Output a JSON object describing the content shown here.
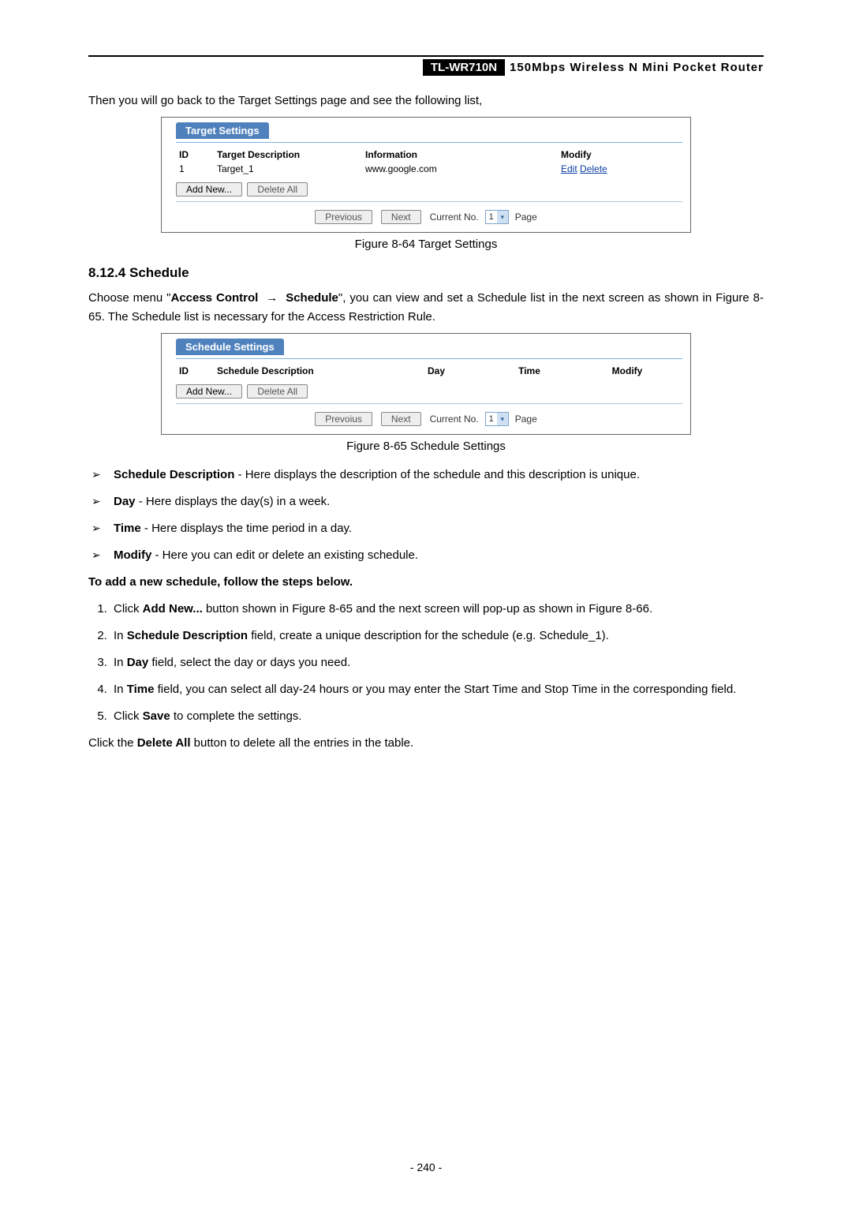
{
  "header": {
    "model": "TL-WR710N",
    "title": "150Mbps Wireless N Mini Pocket Router"
  },
  "intro_line": "Then you will go back to the Target Settings page and see the following list,",
  "fig1": {
    "panel_title": "Target Settings",
    "headers": {
      "id": "ID",
      "desc": "Target Description",
      "info": "Information",
      "modify": "Modify"
    },
    "row": {
      "id": "1",
      "desc": "Target_1",
      "info": "www.google.com",
      "edit": "Edit",
      "delete": "Delete"
    },
    "buttons": {
      "add": "Add New...",
      "del_all": "Delete All"
    },
    "pager": {
      "prev": "Previous",
      "next": "Next",
      "label_pre": "Current No.",
      "value": "1",
      "label_post": "Page"
    },
    "caption": "Figure 8-64    Target Settings"
  },
  "section_heading": "8.12.4 Schedule",
  "para2_parts": {
    "a": "Choose menu \"",
    "b": "Access Control",
    "c": "Schedule",
    "d": "\", you can view and set a Schedule list in the next screen as shown in Figure 8-65. The Schedule list is necessary for the Access Restriction Rule."
  },
  "fig2": {
    "panel_title": "Schedule Settings",
    "headers": {
      "id": "ID",
      "desc": "Schedule Description",
      "day": "Day",
      "time": "Time",
      "modify": "Modify"
    },
    "buttons": {
      "add": "Add New...",
      "del_all": "Delete All"
    },
    "pager": {
      "prev": "Prevoius",
      "next": "Next",
      "label_pre": "Current No.",
      "value": "1",
      "label_post": "Page"
    },
    "caption": "Figure 8-65    Schedule Settings"
  },
  "bullets": [
    {
      "term": "Schedule Description",
      "text": " - Here displays the description of the schedule and this description is unique."
    },
    {
      "term": "Day",
      "text": " - Here displays the day(s) in a week."
    },
    {
      "term": "Time",
      "text": " - Here displays the time period in a day."
    },
    {
      "term": "Modify",
      "text": " - Here you can edit or delete an existing schedule."
    }
  ],
  "add_heading": "To add a new schedule, follow the steps below.",
  "steps": [
    {
      "pre": "Click ",
      "bold": "Add New...",
      "post": " button shown in Figure 8-65 and the next screen will pop-up as shown in Figure 8-66."
    },
    {
      "pre": "In ",
      "bold": "Schedule Description",
      "post": " field, create a unique description for the schedule (e.g. Schedule_1)."
    },
    {
      "pre": "In ",
      "bold": "Day",
      "post": " field, select the day or days you need."
    },
    {
      "pre": "In ",
      "bold": "Time",
      "post": " field, you can select all day-24 hours or you may enter the Start Time and Stop Time in the corresponding field."
    },
    {
      "pre": "Click ",
      "bold": "Save",
      "post": " to complete the settings."
    }
  ],
  "delete_all": {
    "pre": "Click the ",
    "bold": "Delete All",
    "post": " button to delete all the entries in the table."
  },
  "page_number": "- 240 -"
}
